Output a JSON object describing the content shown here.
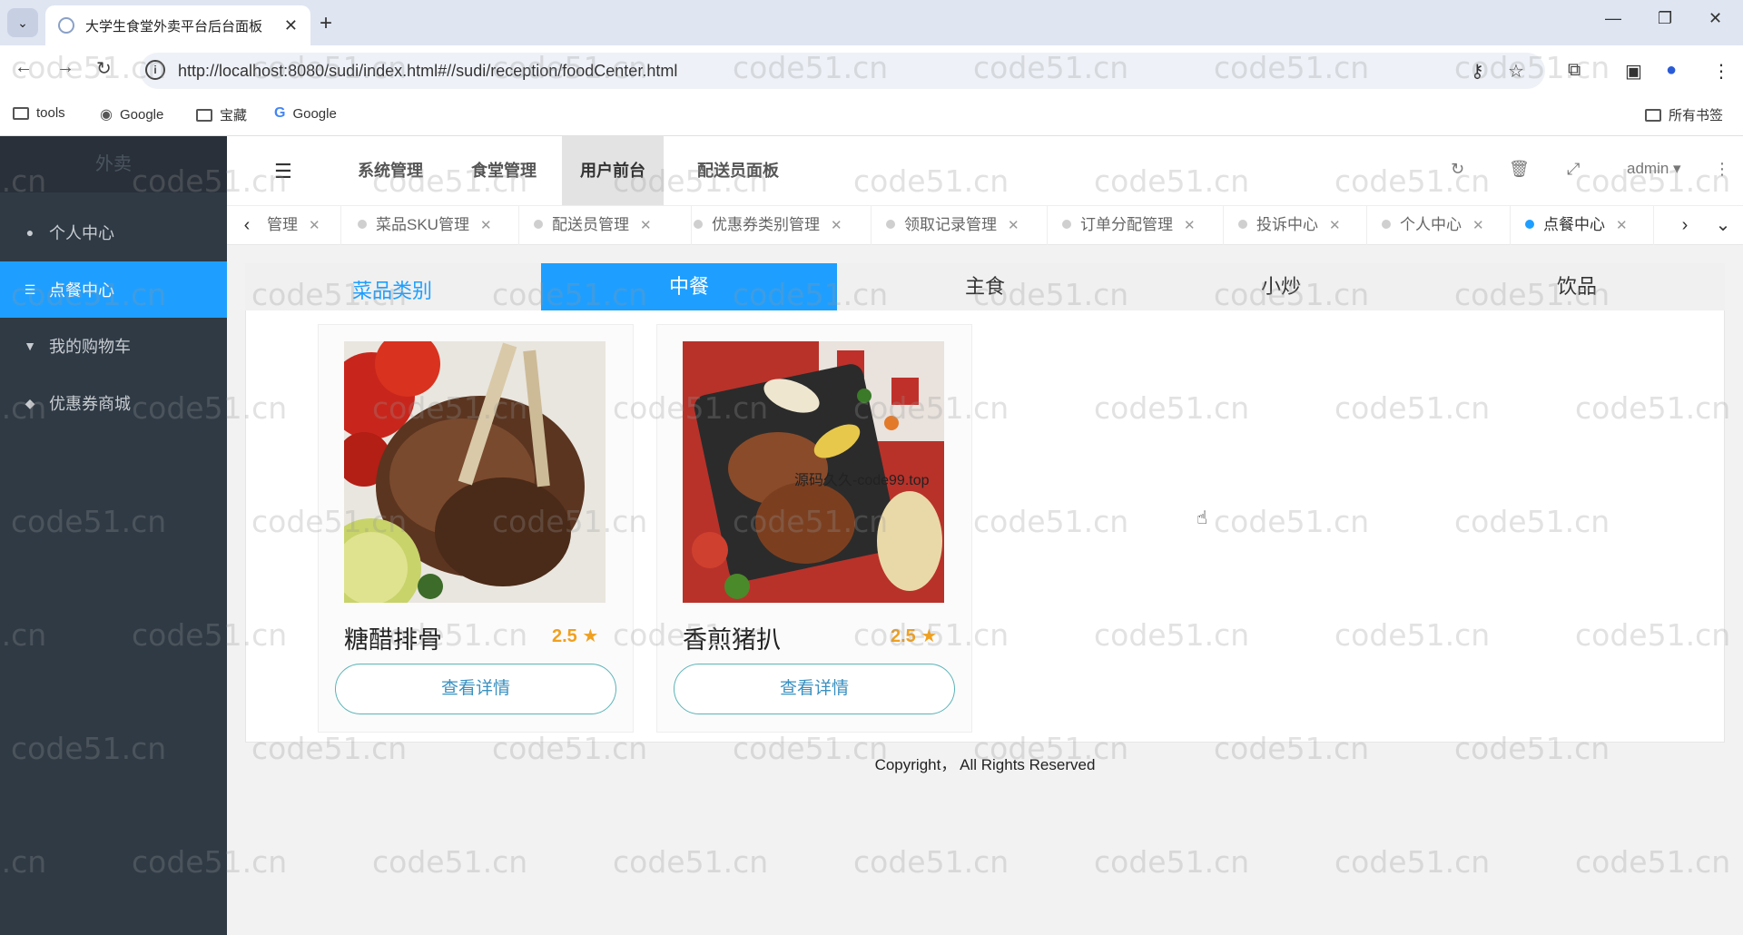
{
  "browser": {
    "tab_title": "大学生食堂外卖平台后台面板",
    "url": "http://localhost:8080/sudi/index.html#//sudi/reception/foodCenter.html",
    "bookmarks": [
      "tools",
      "Google",
      "宝藏",
      "Google"
    ],
    "all_bookmarks": "所有书签"
  },
  "app": {
    "brand": "外卖",
    "sidebar": [
      {
        "label": "个人中心",
        "icon": "user-icon"
      },
      {
        "label": "点餐中心",
        "icon": "order-icon",
        "active": true
      },
      {
        "label": "我的购物车",
        "icon": "cart-icon"
      },
      {
        "label": "优惠券商城",
        "icon": "tag-icon"
      }
    ],
    "top_nav": [
      {
        "label": "系统管理"
      },
      {
        "label": "食堂管理"
      },
      {
        "label": "用户前台",
        "active": true
      },
      {
        "label": "配送员面板"
      }
    ],
    "user": "admin",
    "page_tabs": [
      {
        "label": "管理"
      },
      {
        "label": "菜品SKU管理"
      },
      {
        "label": "配送员管理"
      },
      {
        "label": "优惠券类别管理"
      },
      {
        "label": "领取记录管理"
      },
      {
        "label": "订单分配管理"
      },
      {
        "label": "投诉中心"
      },
      {
        "label": "个人中心"
      },
      {
        "label": "点餐中心",
        "active": true
      }
    ]
  },
  "content": {
    "category_label": "菜品类别",
    "categories": [
      {
        "label": "中餐",
        "active": true
      },
      {
        "label": "主食"
      },
      {
        "label": "小炒"
      },
      {
        "label": "饮品"
      }
    ],
    "dishes": [
      {
        "name": "糖醋排骨",
        "rating": "2.5",
        "button": "查看详情"
      },
      {
        "name": "香煎猪扒",
        "rating": "2.5",
        "button": "查看详情"
      }
    ],
    "overlay_text": "源码久久-code99.top",
    "copyright": "Copyright， All Rights Reserved"
  },
  "watermark": "code51.cn",
  "colors": {
    "accent": "#1e9fff",
    "sidebar": "#2f3a45",
    "rating": "#f0a020"
  }
}
